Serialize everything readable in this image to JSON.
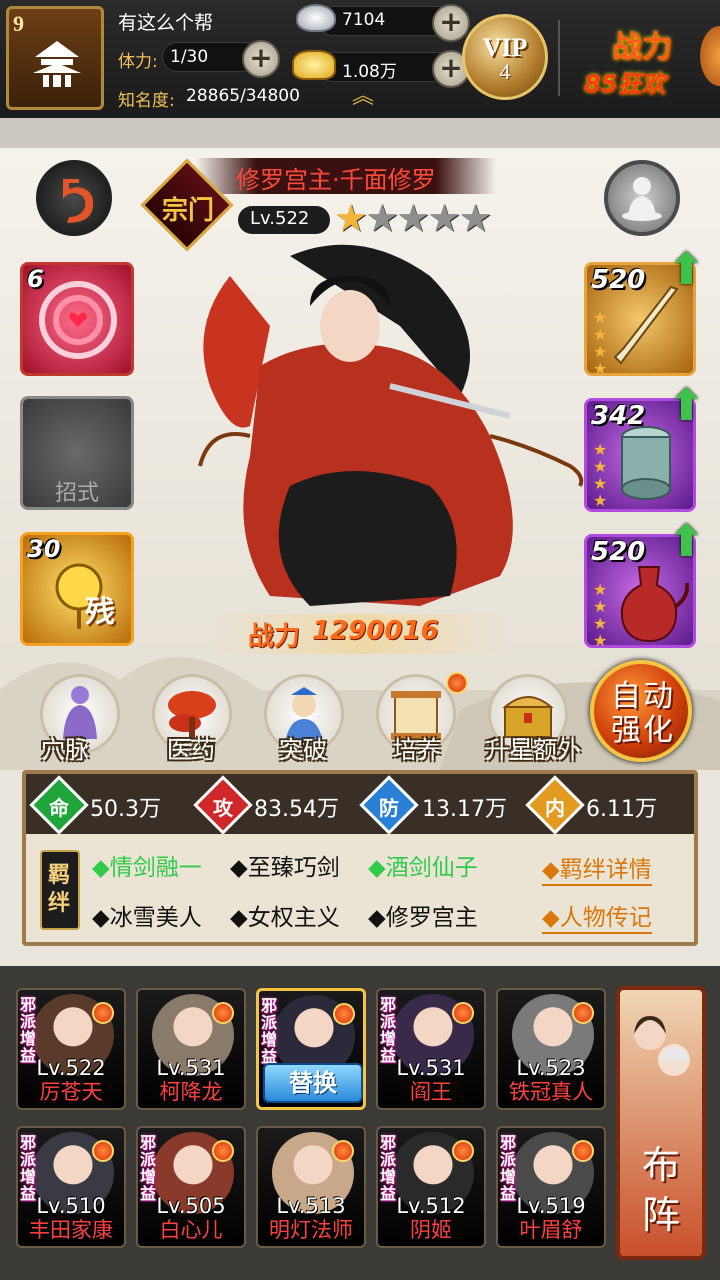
{
  "header": {
    "guild_level": "9",
    "guild_name": "有这么个帮",
    "stamina_label": "体力:",
    "stamina_value": "1/30",
    "fame_label": "知名度:",
    "fame_value": "28865/34800",
    "silver": "7104",
    "gold": "1.08万",
    "vip_label": "VIP",
    "vip_level": "4",
    "combat_event_title": "战力",
    "combat_event_sub": "85狂欢"
  },
  "hero": {
    "title": "修罗宫主·千面修罗",
    "faction_tag": "宗门",
    "level": "Lv.522",
    "stars": 1,
    "max_stars": 5,
    "power_label": "战力",
    "power_value": "1290016",
    "skill_slots": [
      {
        "count": "6",
        "label": ""
      },
      {
        "count": "",
        "label": "招式"
      },
      {
        "count": "30",
        "label": "残"
      }
    ],
    "equipment": [
      {
        "level": "520",
        "item": "sword"
      },
      {
        "level": "342",
        "item": "bracer"
      },
      {
        "level": "520",
        "item": "wine-pot"
      }
    ]
  },
  "menu": [
    {
      "label": "穴脉",
      "dot": false
    },
    {
      "label": "医药",
      "dot": false
    },
    {
      "label": "突破",
      "dot": false
    },
    {
      "label": "培养",
      "dot": true
    },
    {
      "label": "升星额外",
      "dot": false
    }
  ],
  "auto_strengthen": "自动强化",
  "stats": [
    {
      "char": "命",
      "value": "50.3万",
      "color": "#1fa53a"
    },
    {
      "char": "攻",
      "value": "83.54万",
      "color": "#d0282a"
    },
    {
      "char": "防",
      "value": "13.17万",
      "color": "#2a7fd6"
    },
    {
      "char": "内",
      "value": "6.11万",
      "color": "#e39a20"
    }
  ],
  "bonds": {
    "badge": "羁绊",
    "row1": [
      {
        "text": "情剑融一",
        "active": true
      },
      {
        "text": "至臻巧剑",
        "active": false
      },
      {
        "text": "酒剑仙子",
        "active": true
      }
    ],
    "row2": [
      {
        "text": "冰雪美人",
        "active": false
      },
      {
        "text": "女权主义",
        "active": false
      },
      {
        "text": "修罗宫主",
        "active": false
      }
    ],
    "details_link": "羁绊详情",
    "bio_link": "人物传记"
  },
  "roster": {
    "faction_tag": "邪派增益",
    "replace_label": "替换",
    "formation_label": "布阵",
    "row1": [
      {
        "level": "Lv.522",
        "name": "厉苍天",
        "faction": true
      },
      {
        "level": "Lv.531",
        "name": "柯降龙",
        "faction": false
      },
      {
        "level": "",
        "name": "",
        "faction": true,
        "selected": true
      },
      {
        "level": "Lv.531",
        "name": "阎王",
        "faction": true
      },
      {
        "level": "Lv.523",
        "name": "铁冠真人",
        "faction": false
      }
    ],
    "row2": [
      {
        "level": "Lv.510",
        "name": "丰田家康",
        "faction": true
      },
      {
        "level": "Lv.505",
        "name": "白心儿",
        "faction": true
      },
      {
        "level": "Lv.513",
        "name": "明灯法师",
        "faction": false
      },
      {
        "level": "Lv.512",
        "name": "阴姬",
        "faction": true
      },
      {
        "level": "Lv.519",
        "name": "叶眉舒",
        "faction": true
      }
    ]
  }
}
